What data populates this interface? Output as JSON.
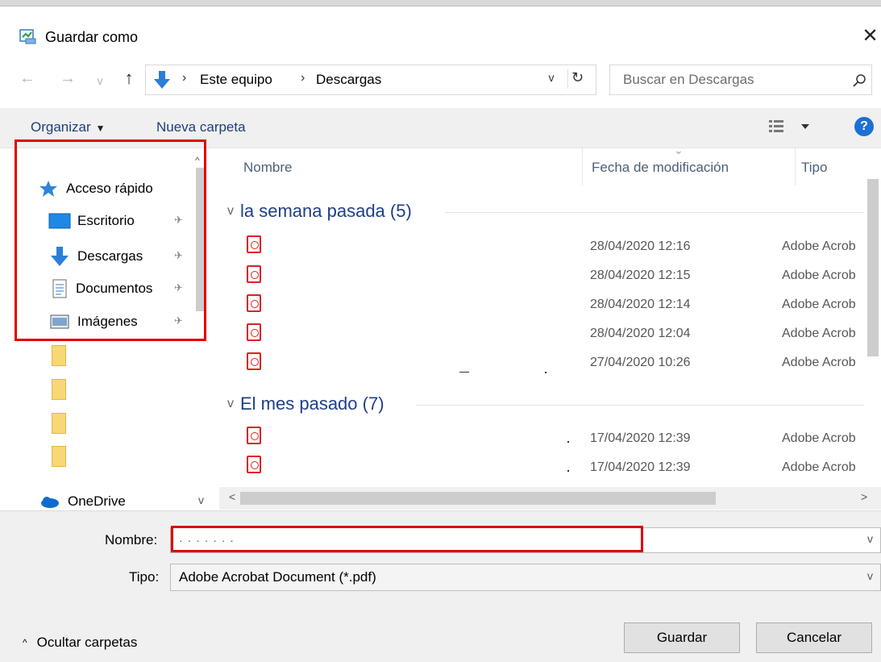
{
  "window": {
    "title": "Guardar como",
    "close_glyph": "✕"
  },
  "navigation": {
    "back_icon": "←",
    "forward_icon": "→",
    "recent_icon": "v",
    "up_icon": "↑",
    "breadcrumb": [
      "Este equipo",
      "Descargas"
    ],
    "separator": "›",
    "dropdown_icon": "v",
    "refresh_icon": "↻",
    "search_placeholder": "Buscar en Descargas"
  },
  "toolbar": {
    "organize_label": "Organizar",
    "organize_caret": "▼",
    "new_folder_label": "Nueva carpeta",
    "help_label": "?"
  },
  "sidebar": {
    "quick_access": "Acceso rápido",
    "items": [
      {
        "label": "Escritorio",
        "icon": "desktop-icon"
      },
      {
        "label": "Descargas",
        "icon": "download-icon"
      },
      {
        "label": "Documentos",
        "icon": "documents-icon"
      },
      {
        "label": "Imágenes",
        "icon": "pictures-icon"
      }
    ],
    "pin_glyph": "✈",
    "onedrive": "OneDrive",
    "scroll_up": "^",
    "scroll_down": "v"
  },
  "file_list": {
    "columns": [
      "Nombre",
      "Fecha de modificación",
      "Tipo"
    ],
    "groups": [
      {
        "title": "la semana pasada (5)",
        "files": [
          {
            "date": "28/04/2020 12:16",
            "type": "Adobe Acrob"
          },
          {
            "date": "28/04/2020 12:15",
            "type": "Adobe Acrob"
          },
          {
            "date": "28/04/2020 12:14",
            "type": "Adobe Acrob"
          },
          {
            "date": "28/04/2020 12:04",
            "type": "Adobe Acrob"
          },
          {
            "date": "27/04/2020 10:26",
            "type": "Adobe Acrob"
          }
        ]
      },
      {
        "title": "El mes pasado (7)",
        "files": [
          {
            "date": "17/04/2020 12:39",
            "type": "Adobe Acrob"
          },
          {
            "date": "17/04/2020 12:39",
            "type": "Adobe Acrob"
          }
        ]
      }
    ],
    "group_caret": "v",
    "hscroll_left": "<",
    "hscroll_right": ">"
  },
  "form": {
    "name_label": "Nombre:",
    "name_value": "· · · ·  · · ·",
    "type_label": "Tipo:",
    "type_value": "Adobe Acrobat Document (*.pdf)",
    "dropdown_glyph": "v"
  },
  "footer": {
    "hide_folders_caret": "^",
    "hide_folders_label": "Ocultar carpetas",
    "save_label": "Guardar",
    "cancel_label": "Cancelar"
  },
  "colors": {
    "highlight": "#e00000",
    "accent": "#1c70d6",
    "group_header": "#1e3f8a",
    "pdf_red": "#e02020"
  }
}
